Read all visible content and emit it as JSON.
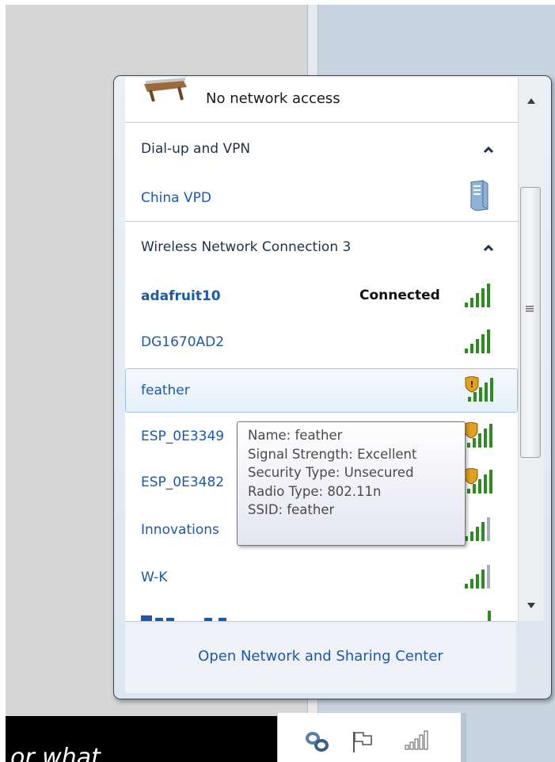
{
  "flyout": {
    "top_item": {
      "label": "No network access",
      "icon": "network-icon"
    },
    "groups": [
      {
        "header": "Dial-up and VPN",
        "collapse_icon": "chevron-up-icon",
        "items": [
          {
            "name": "China VPD",
            "icon": "vpn-server-icon"
          }
        ]
      },
      {
        "header": "Wireless Network Connection 3",
        "collapse_icon": "chevron-up-icon",
        "items": [
          {
            "name": "adafruit10",
            "status": "Connected",
            "signal_bars": 5,
            "secured": true
          },
          {
            "name": "DG1670AD2",
            "signal_bars": 5,
            "secured": true
          },
          {
            "name": "feather",
            "signal_bars": 5,
            "secured": false,
            "hovered": true
          },
          {
            "name": "ESP_0E3349",
            "signal_bars": 5,
            "secured": false
          },
          {
            "name": "ESP_0E3482",
            "signal_bars": 5,
            "secured": false
          },
          {
            "name": "Innovations",
            "signal_bars": 4,
            "secured": true
          },
          {
            "name": "W-K",
            "signal_bars": 4,
            "secured": true
          }
        ]
      }
    ],
    "footer_link": "Open Network and Sharing Center"
  },
  "tooltip": {
    "lines": [
      "Name: feather",
      "Signal Strength: Excellent",
      "Security Type: Unsecured",
      "Radio Type: 802.11n",
      "SSID: feather"
    ]
  },
  "background_text": "or what",
  "taskbar": {
    "icons": [
      "network-link-icon",
      "action-center-flag-icon",
      "wireless-signal-icon"
    ]
  },
  "colors": {
    "link": "#1a5aa8",
    "header_text": "#1e3249",
    "signal_green": "#2e8b22",
    "shield_gold": "#e0a020"
  }
}
